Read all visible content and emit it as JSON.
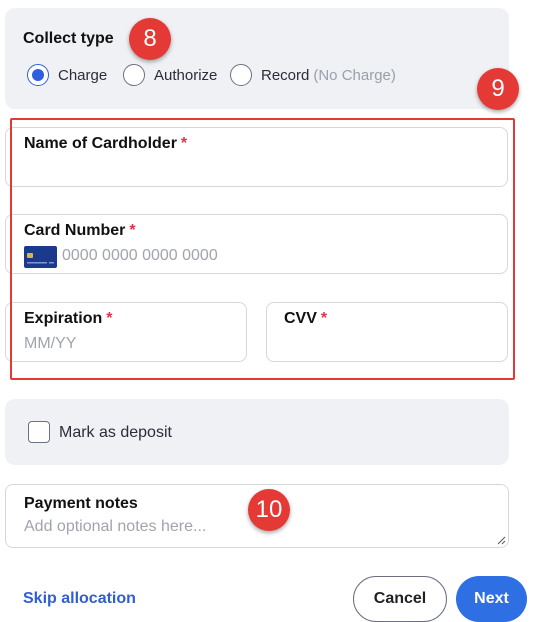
{
  "collect_type": {
    "title": "Collect type",
    "options": [
      {
        "label": "Charge",
        "note": "",
        "selected": true
      },
      {
        "label": "Authorize",
        "note": "",
        "selected": false
      },
      {
        "label": "Record",
        "note": "(No Charge)",
        "selected": false
      }
    ]
  },
  "card_form": {
    "cardholder": {
      "label": "Name of Cardholder",
      "required_mark": "*",
      "placeholder": ""
    },
    "card_number": {
      "label": "Card Number",
      "required_mark": "*",
      "placeholder": "0000 0000 0000 0000",
      "icon": "credit-card-icon"
    },
    "expiration": {
      "label": "Expiration",
      "required_mark": "*",
      "placeholder": "MM/YY"
    },
    "cvv": {
      "label": "CVV",
      "required_mark": "*",
      "placeholder": ""
    }
  },
  "deposit": {
    "label": "Mark as deposit",
    "checked": false
  },
  "payment_notes": {
    "label": "Payment notes",
    "placeholder": "Add optional notes here..."
  },
  "footer": {
    "skip_label": "Skip allocation",
    "cancel_label": "Cancel",
    "next_label": "Next"
  },
  "annotations": {
    "badge_8": "8",
    "badge_9": "9",
    "badge_10": "10"
  },
  "colors": {
    "accent": "#2f6fe4",
    "required": "#e0334b",
    "annotation": "#e53935",
    "panel": "#f0f1f4"
  }
}
